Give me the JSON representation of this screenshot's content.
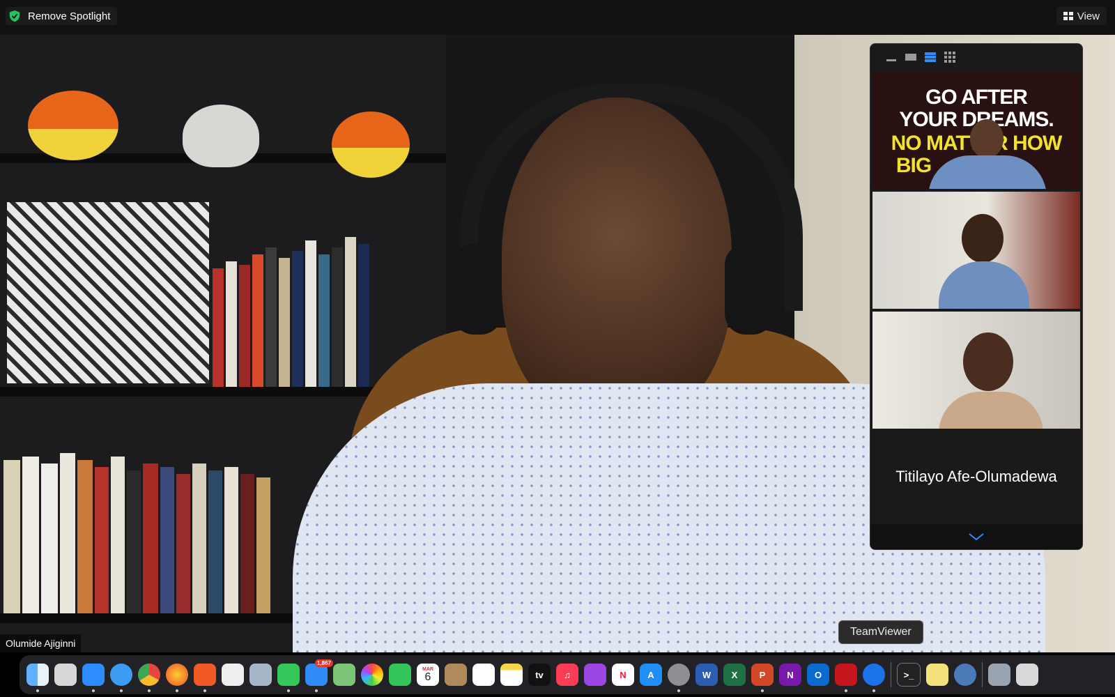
{
  "topbar": {
    "spotlight_label": "Remove Spotlight",
    "view_label": "View"
  },
  "main_video": {
    "participant_name": "Olumide Ajiginni"
  },
  "gallery": {
    "tiles": [
      {
        "banner_text_1": "GO AFTER",
        "banner_text_2": "YOUR DREAMS.",
        "banner_text_3": "NO MATTER HOW",
        "banner_text_4": "BIG"
      },
      {
        "kind": "video"
      },
      {
        "kind": "video"
      }
    ],
    "name_only_tile": "Titilayo Afe-Olumadewa"
  },
  "tooltip": {
    "text": "TeamViewer"
  },
  "dock": {
    "mail_badge": "1,867",
    "calendar_month": "MAR",
    "calendar_day": "6",
    "apps": [
      "finder-icon",
      "launchpad-icon",
      "zoom-icon",
      "safari-icon",
      "chrome-icon",
      "firefox-icon",
      "brave-icon",
      "notes-widget-icon",
      "preview-icon",
      "messages-icon",
      "mail-icon",
      "maps-icon",
      "photos-icon",
      "facetime-icon",
      "calendar-icon",
      "contacts-icon",
      "reminders-icon",
      "notes-icon",
      "apple-tv-icon",
      "music-icon",
      "podcasts-icon",
      "news-icon",
      "app-store-icon",
      "system-preferences-icon",
      "word-icon",
      "excel-icon",
      "powerpoint-icon",
      "onenote-icon",
      "outlook-icon",
      "acrobat-icon",
      "teamviewer-icon",
      "terminal-icon",
      "stickies-icon",
      "quicktime-icon",
      "screenshot-icon",
      "trash-icon"
    ]
  },
  "colors": {
    "accent": "#2d8cff",
    "shield": "#23c45e"
  }
}
